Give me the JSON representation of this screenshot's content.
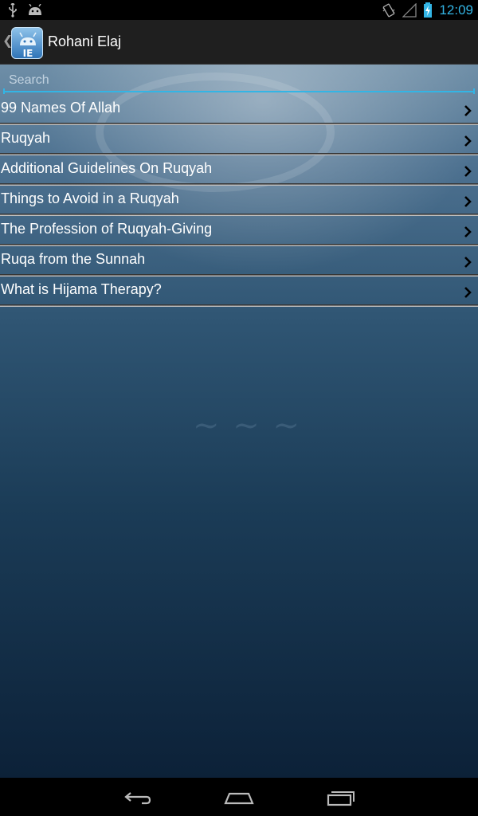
{
  "status_bar": {
    "time": "12:09",
    "icons_left": [
      "usb-icon",
      "android-debug-icon"
    ],
    "icons_right": [
      "vibrate-icon",
      "signal-icon",
      "battery-charging-icon"
    ],
    "accent_color": "#33b5e5"
  },
  "action_bar": {
    "title": "Rohani Elaj",
    "logo_icon": "app-logo-icon"
  },
  "search": {
    "placeholder": "Search",
    "value": ""
  },
  "menu": {
    "items": [
      {
        "label": "99 Names Of Allah"
      },
      {
        "label": "Ruqyah"
      },
      {
        "label": "Additional Guidelines On Ruqyah"
      },
      {
        "label": "Things to Avoid in a Ruqyah"
      },
      {
        "label": "The Profession of Ruqyah-Giving"
      },
      {
        "label": "Ruqa from the Sunnah"
      },
      {
        "label": "What is Hijama Therapy?"
      }
    ]
  },
  "nav_bar": {
    "buttons": [
      "back-icon",
      "home-icon",
      "recent-apps-icon"
    ]
  }
}
